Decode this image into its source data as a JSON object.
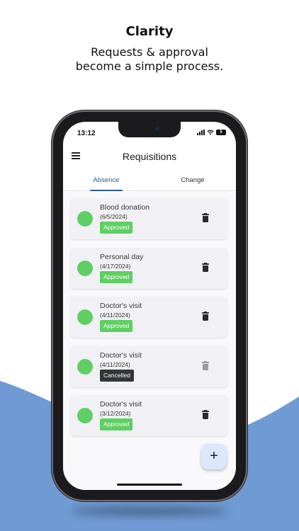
{
  "promo": {
    "title": "Clarity",
    "subtitle_line1": "Requests & approval",
    "subtitle_line2": "become a simple process."
  },
  "status_bar": {
    "time": "13:12",
    "battery": "5"
  },
  "app_bar": {
    "title": "Requisitions",
    "menu_icon": "hamburger-menu-icon"
  },
  "tabs": [
    {
      "label": "Absence",
      "active": true
    },
    {
      "label": "Change",
      "active": false
    }
  ],
  "requests": [
    {
      "title": "Blood donation",
      "date": "(6/5/2024)",
      "status": "Approved"
    },
    {
      "title": "Personal day",
      "date": "(4/17/2024)",
      "status": "Approved"
    },
    {
      "title": "Doctor's visit",
      "date": "(4/11/2024)",
      "status": "Approved"
    },
    {
      "title": "Doctor's visit",
      "date": "(4/11/2024)",
      "status": "Cancelled"
    },
    {
      "title": "Doctor's visit",
      "date": "(3/12/2024)",
      "status": "Approved"
    }
  ],
  "fab": {
    "label": "+",
    "icon": "plus-icon"
  },
  "colors": {
    "wave_blue": "#6f9ad3",
    "approved_green": "#5fcf63",
    "cancelled_dark": "#333537",
    "tab_accent": "#2f5b86",
    "fab_bg": "#dbe7fb"
  }
}
